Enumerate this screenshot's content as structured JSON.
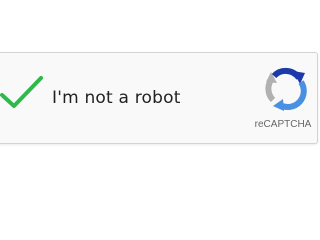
{
  "captcha": {
    "checkbox_state": "checked",
    "checkbox_icon": "checkmark-icon",
    "checkmark_color": "#2fb84c",
    "label": "I'm not a robot",
    "brand": {
      "logo_icon": "recaptcha-logo-icon",
      "name": "reCAPTCHA",
      "colors": {
        "blue_dark": "#1c3aa9",
        "blue_light": "#4a90e2",
        "gray": "#b1b1b1"
      }
    },
    "box_background": "#f9f9f9",
    "box_border": "#d3d3d3"
  }
}
